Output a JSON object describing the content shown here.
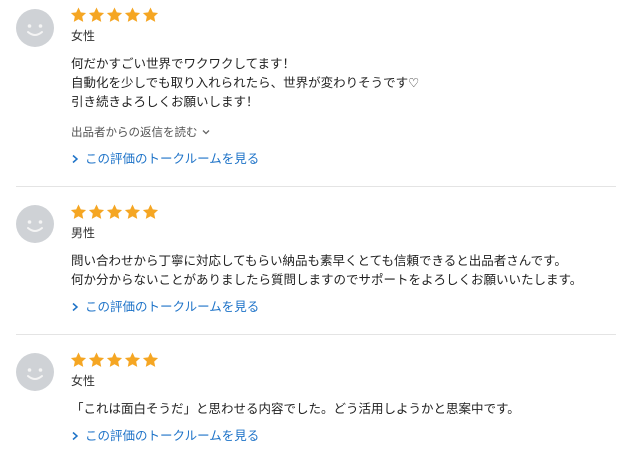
{
  "colors": {
    "star": "#f5a623",
    "link": "#1e73c8",
    "avatar_bg": "#cfd2d6",
    "divider": "#e4e4e4"
  },
  "reviews": [
    {
      "rating": 5,
      "gender": "女性",
      "comment_lines": [
        "何だかすごい世界でワクワクしてます！",
        "自動化を少しでも取り入れられたら、世界が変わりそうです♡",
        "引き続きよろしくお願いします！"
      ],
      "seller_reply_label": "出品者からの返信を読む",
      "talk_link": "この評価のトークルームを見る"
    },
    {
      "rating": 5,
      "gender": "男性",
      "comment_lines": [
        "問い合わせから丁寧に対応してもらい納品も素早くとても信頼できると出品者さんです。",
        "何か分からないことがありましたら質問しますのでサポートをよろしくお願いいたします。"
      ],
      "talk_link": "この評価のトークルームを見る"
    },
    {
      "rating": 5,
      "gender": "女性",
      "comment_lines": [
        "「これは面白そうだ」と思わせる内容でした。どう活用しようかと思案中です。"
      ],
      "talk_link": "この評価のトークルームを見る"
    }
  ]
}
